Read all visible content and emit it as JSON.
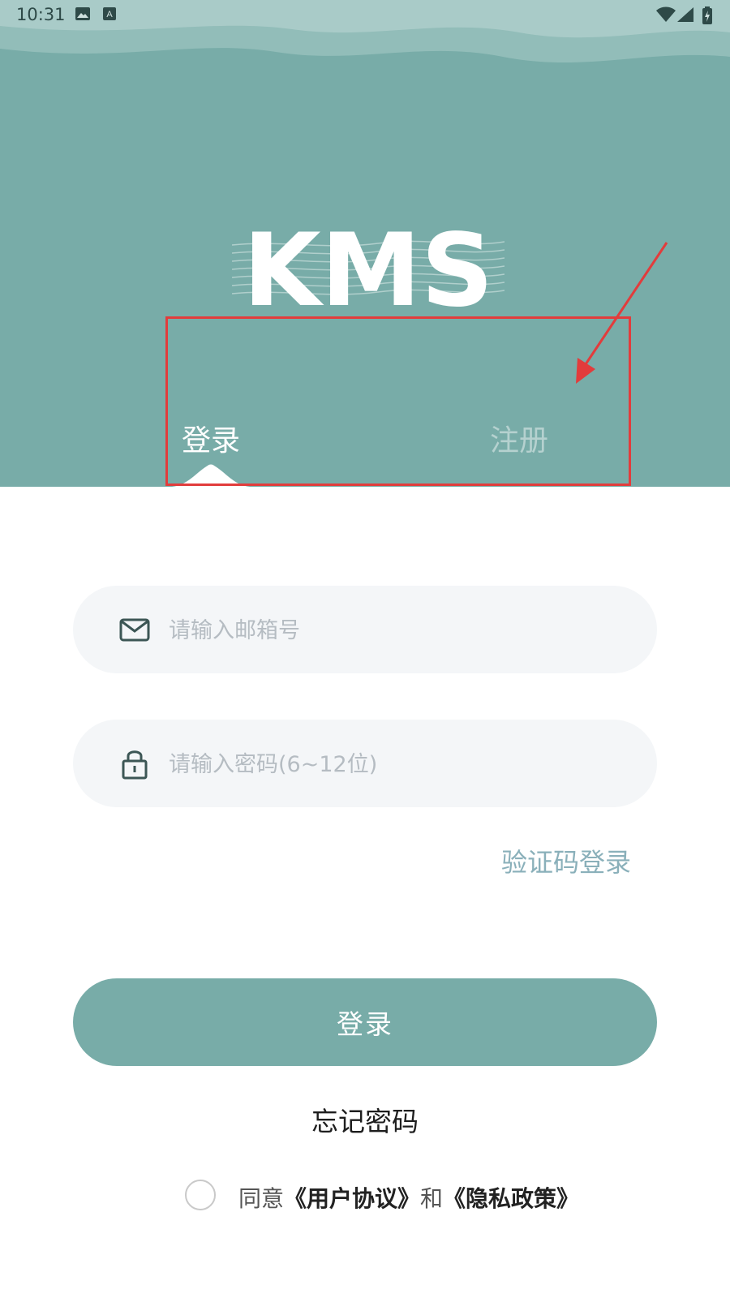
{
  "status_bar": {
    "time": "10:31",
    "icons": [
      "image-icon",
      "keyboard-a-icon",
      "wifi-icon",
      "signal-icon",
      "battery-charging-icon"
    ]
  },
  "logo": {
    "text": "KMS"
  },
  "tabs": [
    {
      "label": "登录",
      "active": true
    },
    {
      "label": "注册",
      "active": false
    }
  ],
  "form": {
    "email": {
      "icon": "mail-icon",
      "placeholder": "请输入邮箱号",
      "value": ""
    },
    "password": {
      "icon": "lock-icon",
      "placeholder": "请输入密码(6~12位)",
      "value": ""
    }
  },
  "sms_login_label": "验证码登录",
  "login_button_label": "登录",
  "forgot_password_label": "忘记密码",
  "agreement": {
    "checked": false,
    "prefix": "同意",
    "user_agreement": "《用户协议》",
    "conjunction": "和",
    "privacy_policy": "《隐私政策》"
  },
  "colors": {
    "brand": "#78aca8",
    "input_bg": "#f4f6f8",
    "sms_link": "#8ab0ba",
    "annotation": "#e23c3c"
  }
}
